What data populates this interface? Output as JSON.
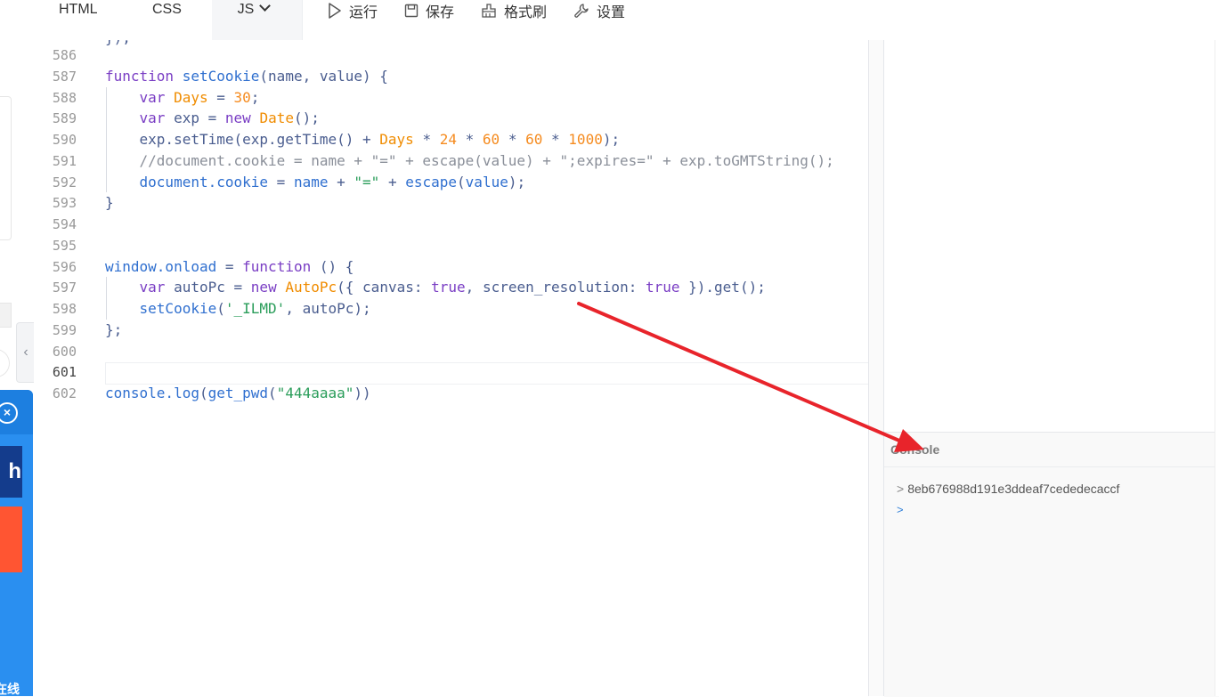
{
  "toolbar": {
    "tabs": [
      {
        "label": "HTML"
      },
      {
        "label": "CSS"
      },
      {
        "label": "JS"
      }
    ],
    "actions": [
      {
        "label": "运行",
        "icon": "play-icon"
      },
      {
        "label": "保存",
        "icon": "floppy-icon"
      },
      {
        "label": "格式刷",
        "icon": "brush-icon"
      },
      {
        "label": "设置",
        "icon": "wrench-icon"
      }
    ]
  },
  "editor": {
    "language": "JS",
    "active_line": 601,
    "lines": [
      {
        "n": 586,
        "html": ""
      },
      {
        "n": 587,
        "html": "<span class='kw'>function</span> <span class='fn'>setCookie</span><span class='pun'>(</span><span class='plain'>name, value</span><span class='pun'>) {</span>"
      },
      {
        "n": 588,
        "html": "    <span class='kw'>var</span> <span class='cls'>Days</span> <span class='pun'>=</span> <span class='num'>30</span><span class='pun'>;</span>"
      },
      {
        "n": 589,
        "html": "    <span class='kw'>var</span> <span class='plain'>exp</span> <span class='pun'>=</span> <span class='kw'>new</span> <span class='cls'>Date</span><span class='pun'>();</span>"
      },
      {
        "n": 590,
        "html": "    <span class='plain'>exp.setTime(exp.getTime()</span> <span class='pun'>+</span> <span class='cls'>Days</span> <span class='pun'>*</span> <span class='num'>24</span> <span class='pun'>*</span> <span class='num'>60</span> <span class='pun'>*</span> <span class='num'>60</span> <span class='pun'>*</span> <span class='num'>1000</span><span class='pun'>);</span>"
      },
      {
        "n": 591,
        "html": "    <span class='cmt'>//document.cookie = name + \"=\" + escape(value) + \";expires=\" + exp.toGMTString();</span>"
      },
      {
        "n": 592,
        "html": "    <span class='fn'>document.cookie</span> <span class='pun'>=</span> <span class='fn'>name</span> <span class='pun'>+</span> <span class='str'>\"=\"</span> <span class='pun'>+</span> <span class='fn'>escape</span><span class='pun'>(</span><span class='fn'>value</span><span class='pun'>);</span>"
      },
      {
        "n": 593,
        "html": "<span class='pun'>}</span>"
      },
      {
        "n": 594,
        "html": ""
      },
      {
        "n": 595,
        "html": ""
      },
      {
        "n": 596,
        "html": "<span class='fn'>window.onload</span> <span class='pun'>=</span> <span class='kw'>function</span> <span class='pun'>() {</span>"
      },
      {
        "n": 597,
        "html": "    <span class='kw'>var</span> <span class='plain'>autoPc</span> <span class='pun'>=</span> <span class='kw'>new</span> <span class='cls'>AutoPc</span><span class='pun'>({</span> <span class='plain'>canvas:</span> <span class='kw'>true</span><span class='pun'>,</span> <span class='plain'>screen_resolution:</span> <span class='kw'>true</span> <span class='pun'>}).get();</span>"
      },
      {
        "n": 598,
        "html": "    <span class='fn'>setCookie</span><span class='pun'>(</span><span class='str'>'_ILMD'</span><span class='pun'>,</span> <span class='plain'>autoPc</span><span class='pun'>);</span>"
      },
      {
        "n": 599,
        "html": "<span class='pun'>};</span>"
      },
      {
        "n": 600,
        "html": ""
      },
      {
        "n": 601,
        "html": ""
      },
      {
        "n": 602,
        "html": "<span class='fn'>console.log</span><span class='pun'>(</span><span class='fn'>get_pwd</span><span class='pun'>(</span><span class='str'>\"444aaaa\"</span><span class='pun'>))</span>"
      }
    ]
  },
  "console": {
    "title": "Console",
    "output": [
      {
        "prompt": ">",
        "text": "8eb676988d191e3ddeaf7cededecaccf"
      }
    ],
    "input_prompt": ">"
  },
  "side_ad": {
    "logo_text": "h",
    "bottom_text": "在线"
  },
  "colors": {
    "keyword": "#7a3ec4",
    "function": "#2f6fcf",
    "number": "#f58b1f",
    "string": "#2a9d5a",
    "comment": "#8a8f99",
    "annotation_arrow": "#e8242b",
    "ad_blue": "#2a8ff0"
  }
}
